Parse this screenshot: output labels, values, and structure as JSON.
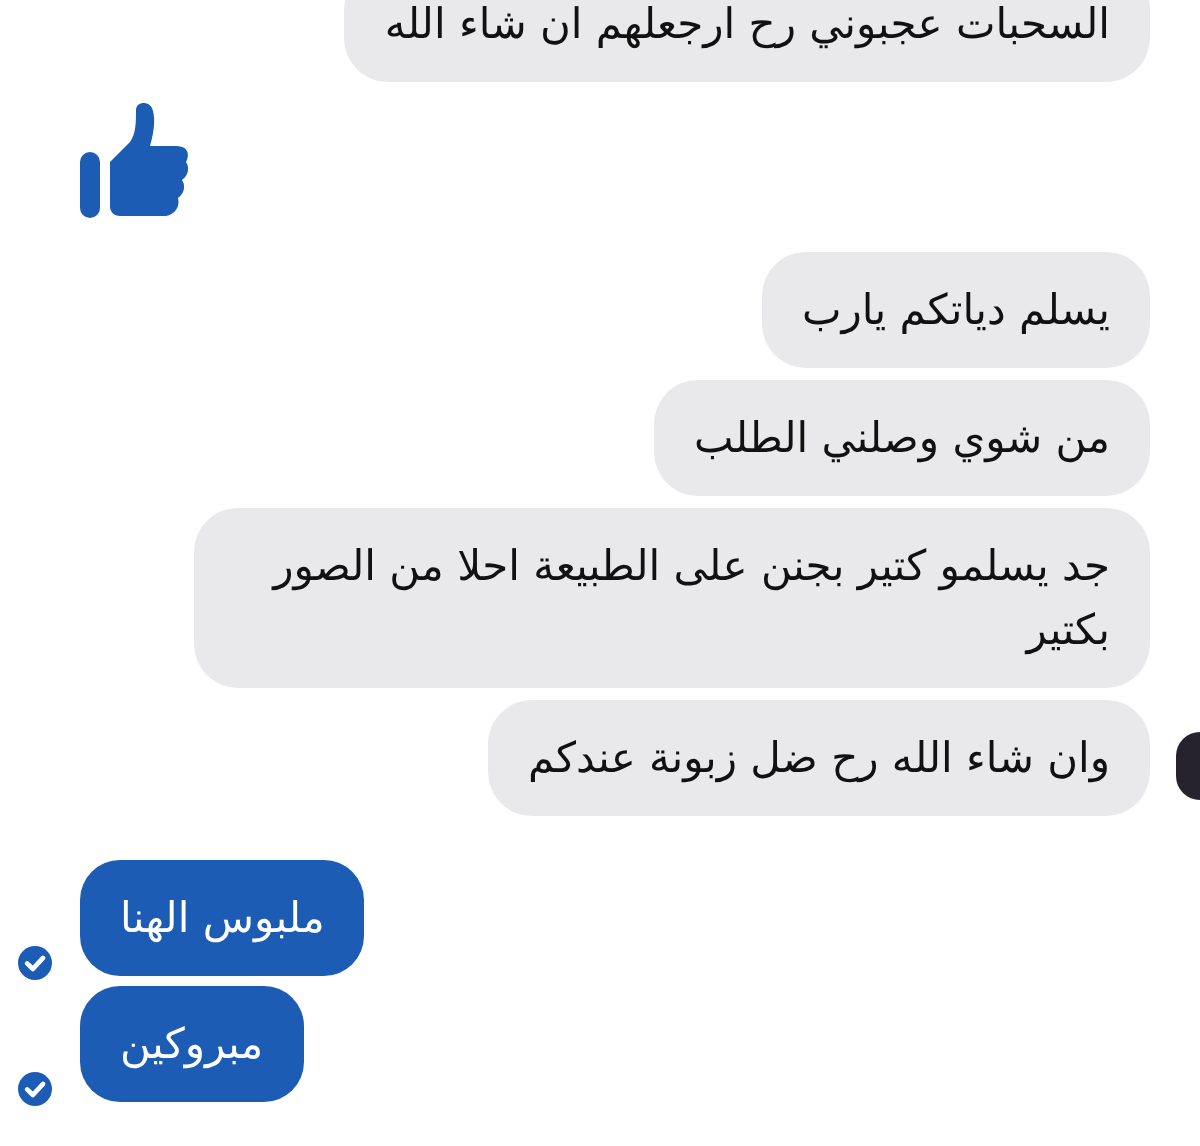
{
  "messages": [
    {
      "kind": "received",
      "text": "السحبات عجبوني رح ارجعلهم ان شاء الله",
      "show_avatar": false
    },
    {
      "kind": "like"
    },
    {
      "kind": "received",
      "text": "يسلم دياتكم يارب",
      "show_avatar": false
    },
    {
      "kind": "received",
      "text": "من شوي وصلني الطلب",
      "show_avatar": false
    },
    {
      "kind": "received",
      "text": "جد يسلمو كتير بجنن على الطبيعة احلا من الصور بكتير",
      "show_avatar": false
    },
    {
      "kind": "received",
      "text": "وان شاء الله رح ضل زبونة عندكم",
      "show_avatar": true
    },
    {
      "kind": "sent",
      "text": "ملبوس الهنا",
      "delivered": true
    },
    {
      "kind": "sent",
      "text": "مبروكين",
      "delivered": true
    }
  ]
}
